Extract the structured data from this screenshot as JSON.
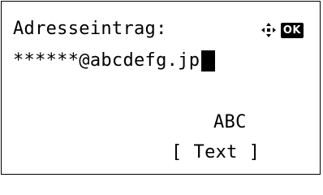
{
  "screen": {
    "title": "Adresseintrag:",
    "entry_value": "******@abcdefg.jp",
    "input_mode": "ABC",
    "softkey": {
      "open_bracket": "[",
      "label": "Text",
      "close_bracket": "]"
    },
    "ok_badge": "OK"
  },
  "icons": {
    "nav": "four-way-navigation-icon",
    "ok": "ok-key-icon"
  },
  "colors": {
    "background": "#ffffff",
    "foreground": "#000000"
  }
}
